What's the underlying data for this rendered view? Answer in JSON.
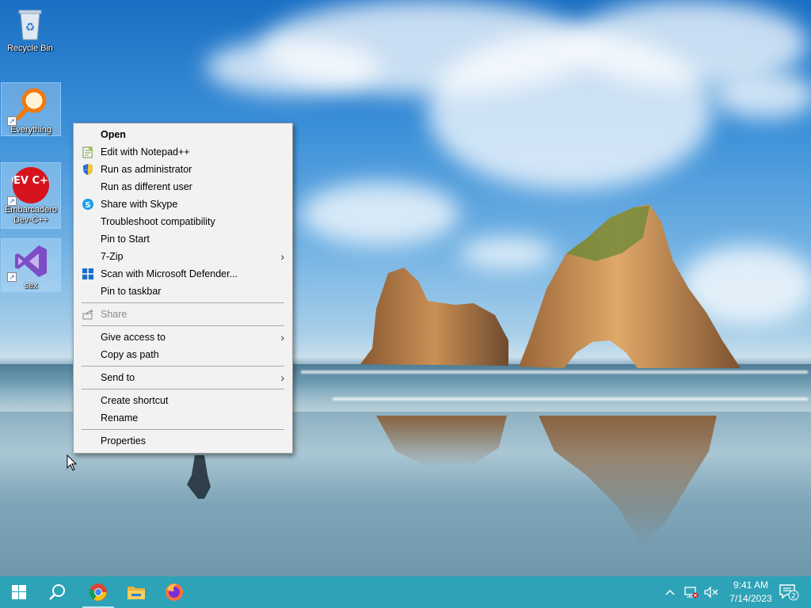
{
  "desktop_icons": [
    {
      "label": "Recycle Bin",
      "icon": "recycle-bin-icon"
    },
    {
      "label": "Everything",
      "icon": "everything-search-icon"
    },
    {
      "label": "Embarcadero Dev-C++",
      "icon": "dev-cpp-icon",
      "logo_text": "DEV C++"
    },
    {
      "label": "sex",
      "icon": "visual-studio-icon"
    }
  ],
  "context_menu": {
    "items": [
      {
        "label": "Open",
        "bold": true
      },
      {
        "label": "Edit with Notepad++",
        "icon": "notepad-plus-plus-icon"
      },
      {
        "label": "Run as administrator",
        "icon": "uac-shield-icon"
      },
      {
        "label": "Run as different user"
      },
      {
        "label": "Share with Skype",
        "icon": "skype-icon"
      },
      {
        "label": "Troubleshoot compatibility"
      },
      {
        "label": "Pin to Start"
      },
      {
        "label": "7-Zip",
        "submenu": true
      },
      {
        "label": "Scan with Microsoft Defender...",
        "icon": "defender-icon"
      },
      {
        "label": "Pin to taskbar"
      },
      {
        "label": "Share",
        "icon": "share-icon",
        "disabled": true
      },
      {
        "label": "Give access to",
        "submenu": true
      },
      {
        "label": "Copy as path"
      },
      {
        "label": "Send to",
        "submenu": true
      },
      {
        "label": "Create shortcut"
      },
      {
        "label": "Rename"
      },
      {
        "label": "Properties"
      }
    ],
    "submenu_arrow": "›"
  },
  "taskbar": {
    "buttons": [
      "start-button",
      "search-button",
      "chrome-button",
      "file-explorer-button",
      "firefox-button"
    ],
    "active": "chrome-button",
    "color": "#2ea3b7"
  },
  "tray": {
    "time": "9:41 AM",
    "date": "7/14/2023",
    "notification_count": "2"
  }
}
